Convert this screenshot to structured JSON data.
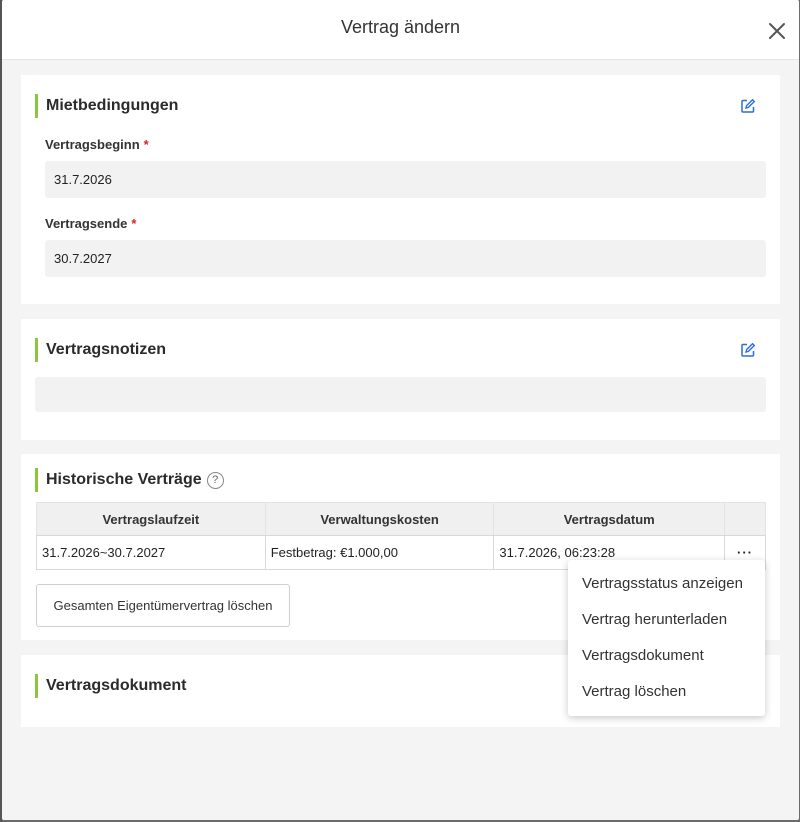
{
  "modal": {
    "title": "Vertrag ändern"
  },
  "lease_terms": {
    "title": "Mietbedingungen",
    "start_label": "Vertragsbeginn",
    "start_value": "31.7.2026",
    "end_label": "Vertragsende",
    "end_value": "30.7.2027",
    "required_mark": "*"
  },
  "notes": {
    "title": "Vertragsnotizen",
    "value": ""
  },
  "history": {
    "title": "Historische Verträge",
    "help": "?",
    "columns": [
      "Vertragslaufzeit",
      "Verwaltungskosten",
      "Vertragsdatum"
    ],
    "rows": [
      {
        "term": "31.7.2026~30.7.2027",
        "fee": "Festbetrag: €1.000,00",
        "date": "31.7.2026, 06:23:28",
        "more": "···"
      }
    ],
    "delete_all_label": "Gesamten Eigentümervertrag löschen"
  },
  "document": {
    "title": "Vertragsdokument"
  },
  "context_menu": {
    "items": [
      "Vertragsstatus anzeigen",
      "Vertrag herunterladen",
      "Vertragsdokument",
      "Vertrag löschen"
    ]
  },
  "colors": {
    "accent_bar": "#8cc63f",
    "edit_icon": "#2f6fd1",
    "required": "#e02020"
  },
  "icons": [
    "close-icon",
    "edit-icon",
    "help-icon",
    "more-icon"
  ]
}
